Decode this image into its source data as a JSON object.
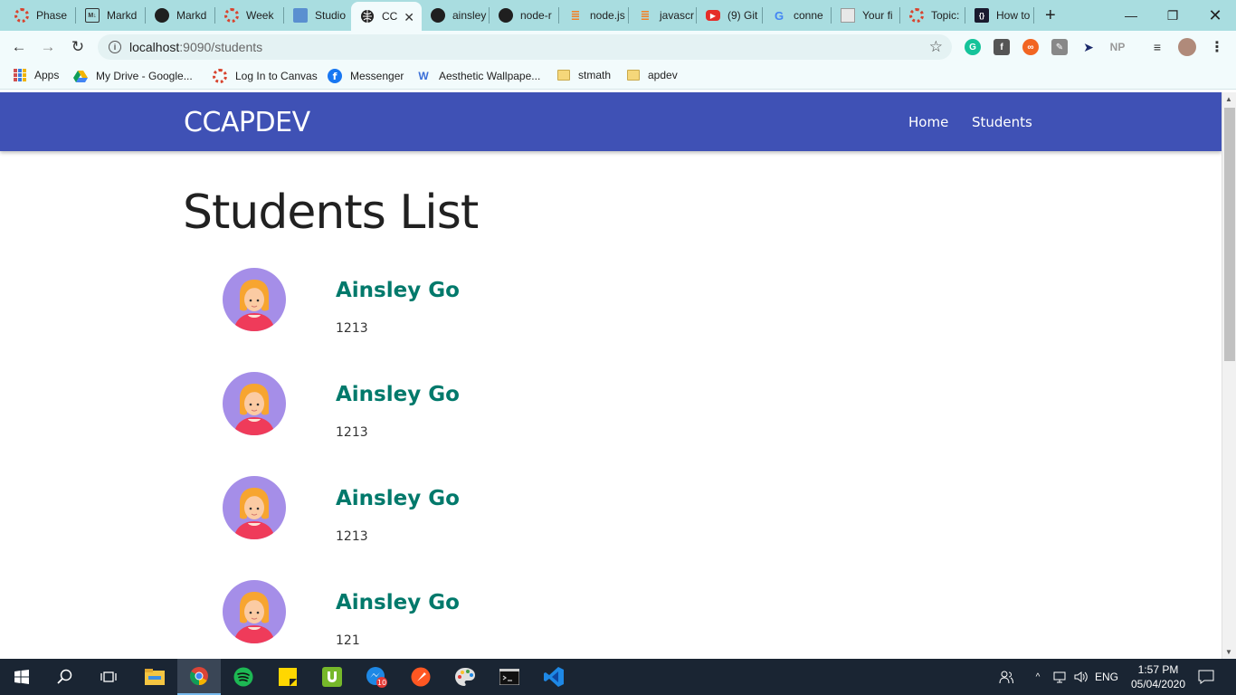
{
  "browser": {
    "tabs": [
      {
        "title": "Phase",
        "icon": "ring-icon"
      },
      {
        "title": "Markd",
        "icon": "markdown-icon"
      },
      {
        "title": "Markd",
        "icon": "github-icon"
      },
      {
        "title": "Week",
        "icon": "ring-icon"
      },
      {
        "title": "Studio",
        "icon": "studio-icon"
      },
      {
        "title": "CC",
        "icon": "globe-icon",
        "active": true
      },
      {
        "title": "ainsley",
        "icon": "github-icon"
      },
      {
        "title": "node-r",
        "icon": "github-icon"
      },
      {
        "title": "node.js",
        "icon": "stackoverflow-icon"
      },
      {
        "title": "javascr",
        "icon": "stackoverflow-icon"
      },
      {
        "title": "(9) Git",
        "icon": "youtube-icon"
      },
      {
        "title": "conne",
        "icon": "google-icon"
      },
      {
        "title": "Your fi",
        "icon": "document-icon"
      },
      {
        "title": "Topic:",
        "icon": "ring-icon"
      },
      {
        "title": "How to",
        "icon": "code-icon"
      }
    ],
    "address": {
      "host": "localhost",
      "path": ":9090/students"
    },
    "bookmarks": [
      {
        "label": "Apps",
        "icon": "apps-icon"
      },
      {
        "label": "My Drive - Google...",
        "icon": "drive-icon"
      },
      {
        "label": "Log In to Canvas",
        "icon": "canvas-icon"
      },
      {
        "label": "Messenger",
        "icon": "messenger-icon"
      },
      {
        "label": "Aesthetic Wallpape...",
        "icon": "wallpaper-icon"
      },
      {
        "label": "stmath",
        "icon": "folder-icon"
      },
      {
        "label": "apdev",
        "icon": "folder-icon"
      }
    ],
    "extensions": [
      "grammarly-icon",
      "facebook-icon",
      "infinity-icon",
      "edit-icon",
      "pointer-icon",
      "np-icon",
      "playlist-icon",
      "profile-avatar-icon",
      "menu-dots-icon"
    ]
  },
  "page": {
    "brand": "CCAPDEV",
    "nav": {
      "home": "Home",
      "students": "Students"
    },
    "title": "Students List",
    "students": [
      {
        "name": "Ainsley Go",
        "id": "1213"
      },
      {
        "name": "Ainsley Go",
        "id": "1213"
      },
      {
        "name": "Ainsley Go",
        "id": "1213"
      },
      {
        "name": "Ainsley Go",
        "id": "121"
      }
    ]
  },
  "taskbar": {
    "apps": [
      "start-icon",
      "search-icon",
      "task-view-icon",
      "file-explorer-icon",
      "chrome-icon",
      "spotify-icon",
      "sticky-notes-icon",
      "utorrent-icon",
      "messenger-icon",
      "paint-icon",
      "palette-icon",
      "terminal-icon",
      "vscode-icon"
    ],
    "badge_count": "10",
    "language": "ENG",
    "time": "1:57 PM",
    "date": "05/04/2020"
  },
  "colors": {
    "navbar": "#3f51b5",
    "student_name": "#00796b",
    "tab_strip": "#a9dde0",
    "taskbar": "#1a2533"
  }
}
